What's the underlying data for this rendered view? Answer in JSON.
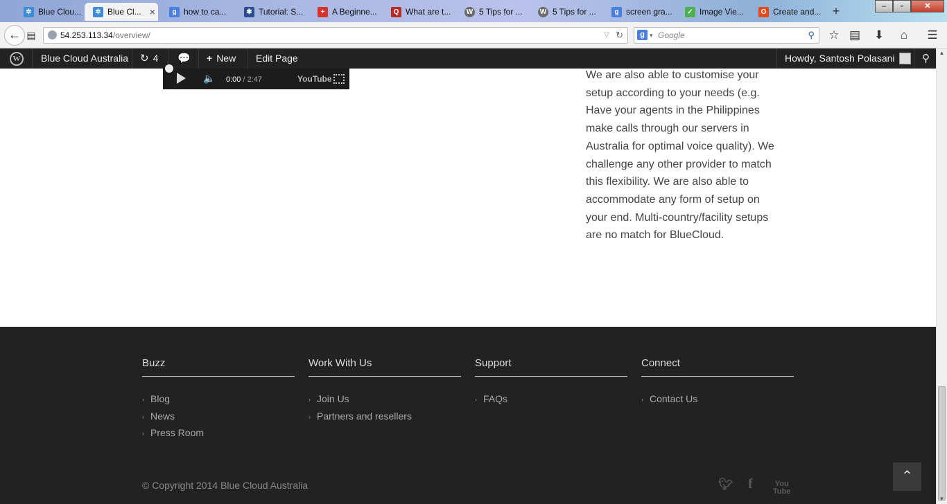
{
  "browser": {
    "tabs": [
      {
        "label": "Blue Clou...",
        "icon": "snowflake-icon",
        "color": "#3b8bd6"
      },
      {
        "label": "Blue Cl...",
        "icon": "snowflake-icon",
        "color": "#3b8bd6",
        "active": true
      },
      {
        "label": "how to ca...",
        "icon": "google-icon",
        "color": "#4a7de0"
      },
      {
        "label": "Tutorial: S...",
        "icon": "star-icon",
        "color": "#2a4b8d"
      },
      {
        "label": "A Beginne...",
        "icon": "plus-cross-icon",
        "color": "#d9322c"
      },
      {
        "label": "What are t...",
        "icon": "quora-icon",
        "color": "#b92b27"
      },
      {
        "label": "5 Tips for ...",
        "icon": "wordpress-icon",
        "color": "#6b6b6b"
      },
      {
        "label": "5 Tips for ...",
        "icon": "wordpress-icon",
        "color": "#6b6b6b"
      },
      {
        "label": "screen gra...",
        "icon": "google-icon",
        "color": "#4a7de0"
      },
      {
        "label": "Image Vie...",
        "icon": "checkmark-icon",
        "color": "#4caf50"
      },
      {
        "label": "Create and...",
        "icon": "office-icon",
        "color": "#e64a19"
      }
    ],
    "url_host": "54.253.113.34",
    "url_path": "/overview/",
    "search_placeholder": "Google",
    "search_engine_letter": "g"
  },
  "adminbar": {
    "site_name": "Blue Cloud Australia",
    "updates_count": "4",
    "new_label": "New",
    "edit_label": "Edit Page",
    "howdy": "Howdy, Santosh Polasani"
  },
  "video": {
    "current_time": "0:00",
    "duration": "/ 2:47",
    "brand": "YouTube"
  },
  "content": {
    "paragraph": "We are also able to customise your setup according to your needs (e.g. Have your agents in the Philippines make calls through our servers in Australia for optimal voice quality). We challenge any other provider to match this flexibility. We are also able to accommodate any form of setup on your end. Multi-country/facility setups are no match for BlueCloud."
  },
  "footer": {
    "columns": [
      {
        "title": "Buzz",
        "links": [
          "Blog",
          "News",
          "Press Room"
        ]
      },
      {
        "title": "Work With Us",
        "links": [
          "Join Us",
          "Partners and resellers"
        ]
      },
      {
        "title": "Support",
        "links": [
          "FAQs"
        ]
      },
      {
        "title": "Connect",
        "links": [
          "Contact Us"
        ]
      }
    ],
    "copyright": "© Copyright 2014 Blue Cloud Australia",
    "social": [
      "twitter-icon",
      "facebook-icon",
      "youtube-icon"
    ]
  }
}
